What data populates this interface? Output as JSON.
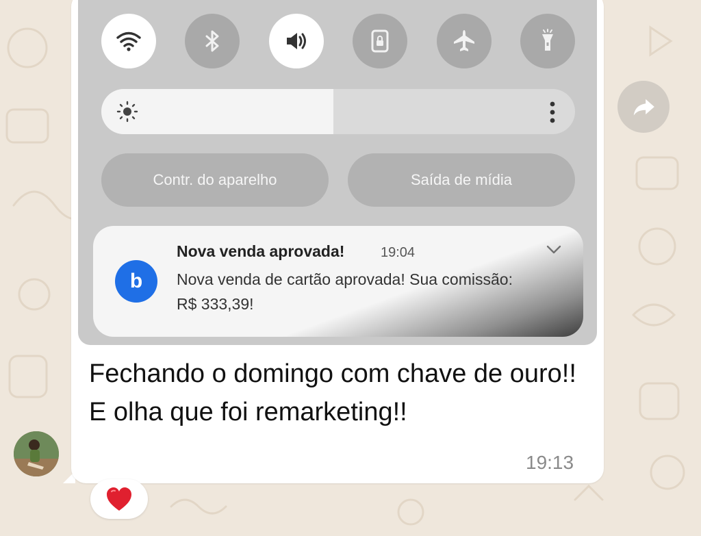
{
  "quick_settings": {
    "toggles": [
      {
        "icon": "wifi-icon",
        "state": "on"
      },
      {
        "icon": "bluetooth-icon",
        "state": "off"
      },
      {
        "icon": "sound-icon",
        "state": "on"
      },
      {
        "icon": "rotation-lock-icon",
        "state": "off"
      },
      {
        "icon": "airplane-icon",
        "state": "off"
      },
      {
        "icon": "flashlight-icon",
        "state": "off"
      }
    ],
    "brightness_level": 0.49,
    "device_control_label": "Contr. do aparelho",
    "media_output_label": "Saída de mídia"
  },
  "notification": {
    "app_icon_letter": "b",
    "app_color": "#1f6fe6",
    "title": "Nova venda aprovada!",
    "time": "19:04",
    "body": "Nova venda de cartão aprovada! Sua comissão: R$ 333,39!"
  },
  "message": {
    "line1": "Fechando o domingo com chave de ouro!!",
    "line2": "E olha que foi remarketing!!",
    "time": "19:13",
    "reaction": "heart-icon"
  }
}
